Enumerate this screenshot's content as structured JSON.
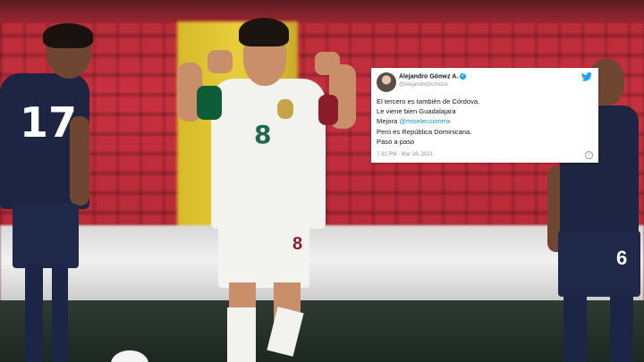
{
  "photo": {
    "left_player_number": "17",
    "center_player_number": "8",
    "center_player_shorts_number": "8",
    "right_player_number": "6"
  },
  "tweet": {
    "author_name": "Alejandro Gómez A.",
    "author_handle": "@AlejandroGomezA",
    "lines": {
      "l1": "El tercero es también de Córdova.",
      "l2": "Le viene bien Guadalajara",
      "l3_prefix": "Mejora ",
      "l3_mention": "@miseleccionmx",
      "l4": "Pero es República Dominicana.",
      "l5": "Paso a paso"
    },
    "timestamp": "7:32 PM · Mar 18, 2021",
    "icons": [
      "twitter-bird-icon",
      "verified-badge-icon",
      "info-icon"
    ],
    "colors": {
      "link": "#1b95e0",
      "bird": "#1da1f2"
    }
  }
}
